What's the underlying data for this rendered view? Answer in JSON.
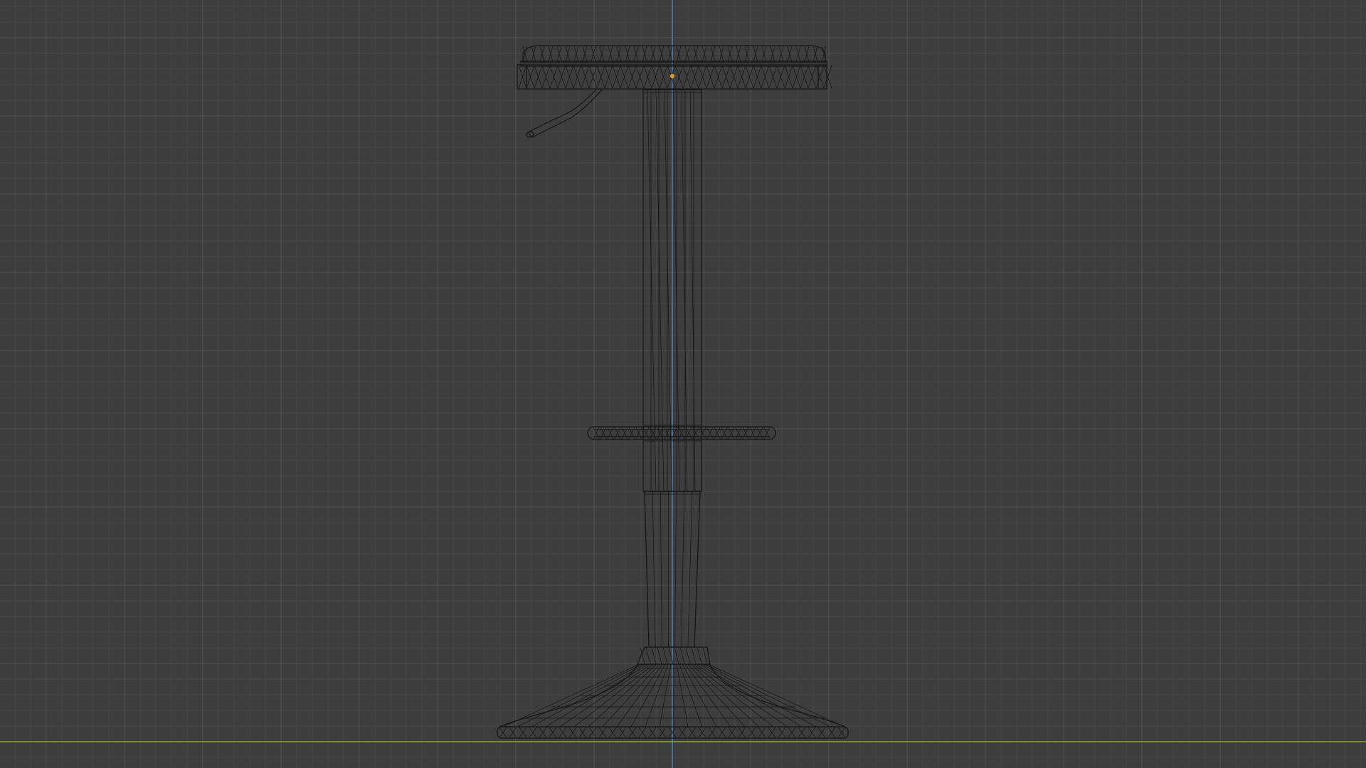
{
  "viewport": {
    "view": "orthographic-front",
    "shading": "wireframe",
    "model": "bar-stool",
    "colors": {
      "background": "#3d3d3d",
      "grid_minor": "#474747",
      "grid_major": "#545454",
      "wire": "#141414",
      "z_axis": "#4a7fc1",
      "x_axis": "#86a83a",
      "origin": "#e0a020"
    },
    "icons": {
      "origin": "object-origin-dot"
    }
  }
}
